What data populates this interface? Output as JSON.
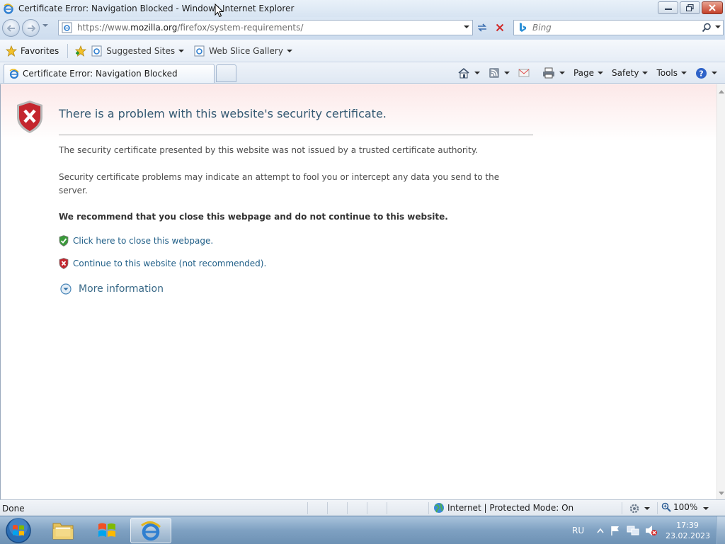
{
  "window": {
    "title": "Certificate Error: Navigation Blocked - Windows Internet Explorer"
  },
  "address_bar": {
    "url_prefix": "https://www.",
    "url_domain": "mozilla.org",
    "url_path": "/firefox/system-requirements/"
  },
  "search": {
    "placeholder": "Bing"
  },
  "favorites_bar": {
    "favorites_label": "Favorites",
    "links": [
      {
        "label": "Suggested Sites",
        "icon": "ie-page-icon"
      },
      {
        "label": "Web Slice Gallery",
        "icon": "ie-page-icon"
      }
    ]
  },
  "tabs": [
    {
      "label": "Certificate Error: Navigation Blocked",
      "icon": "cert-error-icon",
      "active": true
    }
  ],
  "command_bar": {
    "page_label": "Page",
    "safety_label": "Safety",
    "tools_label": "Tools"
  },
  "content": {
    "heading": "There is a problem with this website's security certificate.",
    "para1": "The security certificate presented by this website was not issued by a trusted certificate authority.",
    "para2": "Security certificate problems may indicate an attempt to fool you or intercept any data you send to the server.",
    "recommendation": "We recommend that you close this webpage and do not continue to this website.",
    "close_link": "Click here to close this webpage.",
    "continue_link": "Continue to this website (not recommended).",
    "more_info": "More information"
  },
  "status_bar": {
    "status": "Done",
    "zone": "Internet | Protected Mode: On",
    "zoom": "100%"
  },
  "taskbar": {
    "language": "RU",
    "time": "17:39",
    "date": "23.02.2023"
  },
  "colors": {
    "heading": "#355a73",
    "link": "#1f5e87",
    "error_red": "#c4262e",
    "safe_green": "#3a9a3a",
    "taskbar": "#7fa1c2"
  }
}
